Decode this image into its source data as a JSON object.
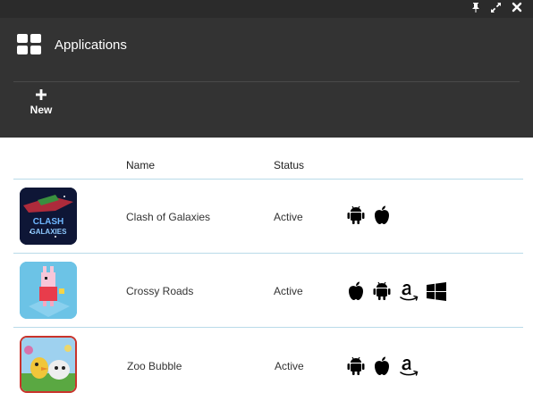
{
  "window": {
    "controls": [
      "pin-icon",
      "expand-icon",
      "close-icon"
    ]
  },
  "header": {
    "icon": "apps-grid-icon",
    "title": "Applications",
    "new_label": "New",
    "background": "#333333"
  },
  "table": {
    "columns": {
      "name": "Name",
      "status": "Status"
    },
    "rows": [
      {
        "name": "Clash of Galaxies",
        "status": "Active",
        "platforms": [
          "android",
          "apple"
        ],
        "thumb_text_1": "CLASH",
        "thumb_text_2": "GALAXIES"
      },
      {
        "name": "Crossy Roads",
        "status": "Active",
        "platforms": [
          "apple",
          "android",
          "amazon",
          "windows"
        ]
      },
      {
        "name": "Zoo Bubble",
        "status": "Active",
        "platforms": [
          "android",
          "apple",
          "amazon"
        ]
      }
    ]
  },
  "colors": {
    "row_divider": "#b9dbe9",
    "header_bg": "#333333"
  }
}
